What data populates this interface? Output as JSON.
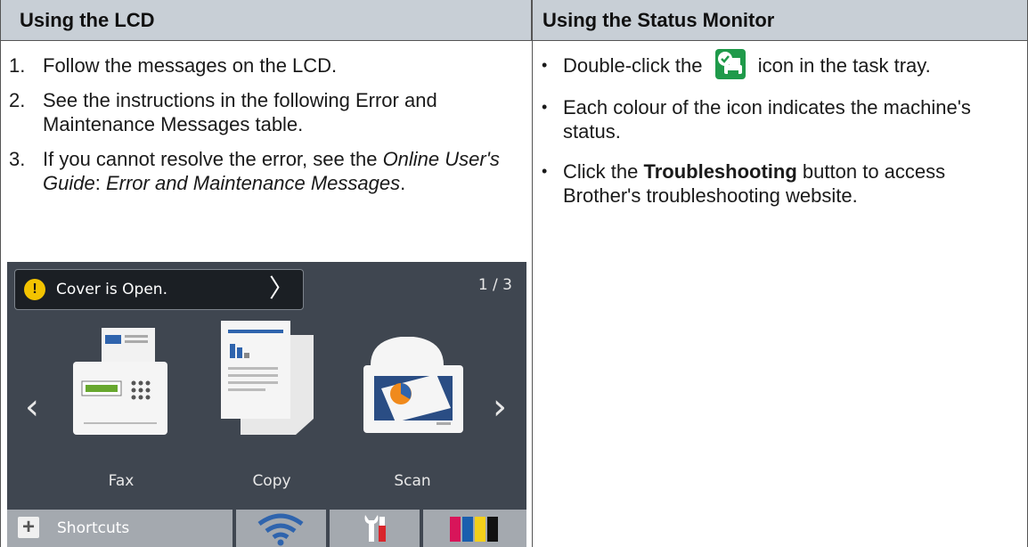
{
  "headers": {
    "left": "Using the LCD",
    "right": "Using the Status Monitor"
  },
  "lcd_steps": [
    {
      "num": "1.",
      "text": "Follow the messages on the LCD."
    },
    {
      "num": "2.",
      "text": "See the instructions in the following Error and Maintenance Messages table."
    },
    {
      "num": "3.",
      "pre": "If you cannot resolve the error, see the ",
      "ref1": "Online User's Guide",
      "sep": ": ",
      "ref2": "Error and Maintenance Messages",
      "post": "."
    }
  ],
  "status_bullets": [
    {
      "pre": "Double-click the ",
      "post": " icon in the task tray."
    },
    {
      "text": "Each colour of the icon indicates the machine's status."
    },
    {
      "pre": "Click the ",
      "bold": "Troubleshooting",
      "post": " button to access Brother's troubleshooting website."
    }
  ],
  "lcd_screen": {
    "message": "Cover is Open.",
    "page_indicator": "1 / 3",
    "icons": [
      {
        "label": "Fax",
        "icon": "fax-icon"
      },
      {
        "label": "Copy",
        "icon": "copy-icon"
      },
      {
        "label": "Scan",
        "icon": "scan-icon"
      }
    ],
    "bottom_bar": {
      "shortcuts_label": "Shortcuts"
    }
  },
  "colors": {
    "header_bg": "#c8cfd6",
    "lcd_bg": "#3f4650",
    "warning": "#f3c300",
    "tray_icon": "#1f9a4a"
  }
}
